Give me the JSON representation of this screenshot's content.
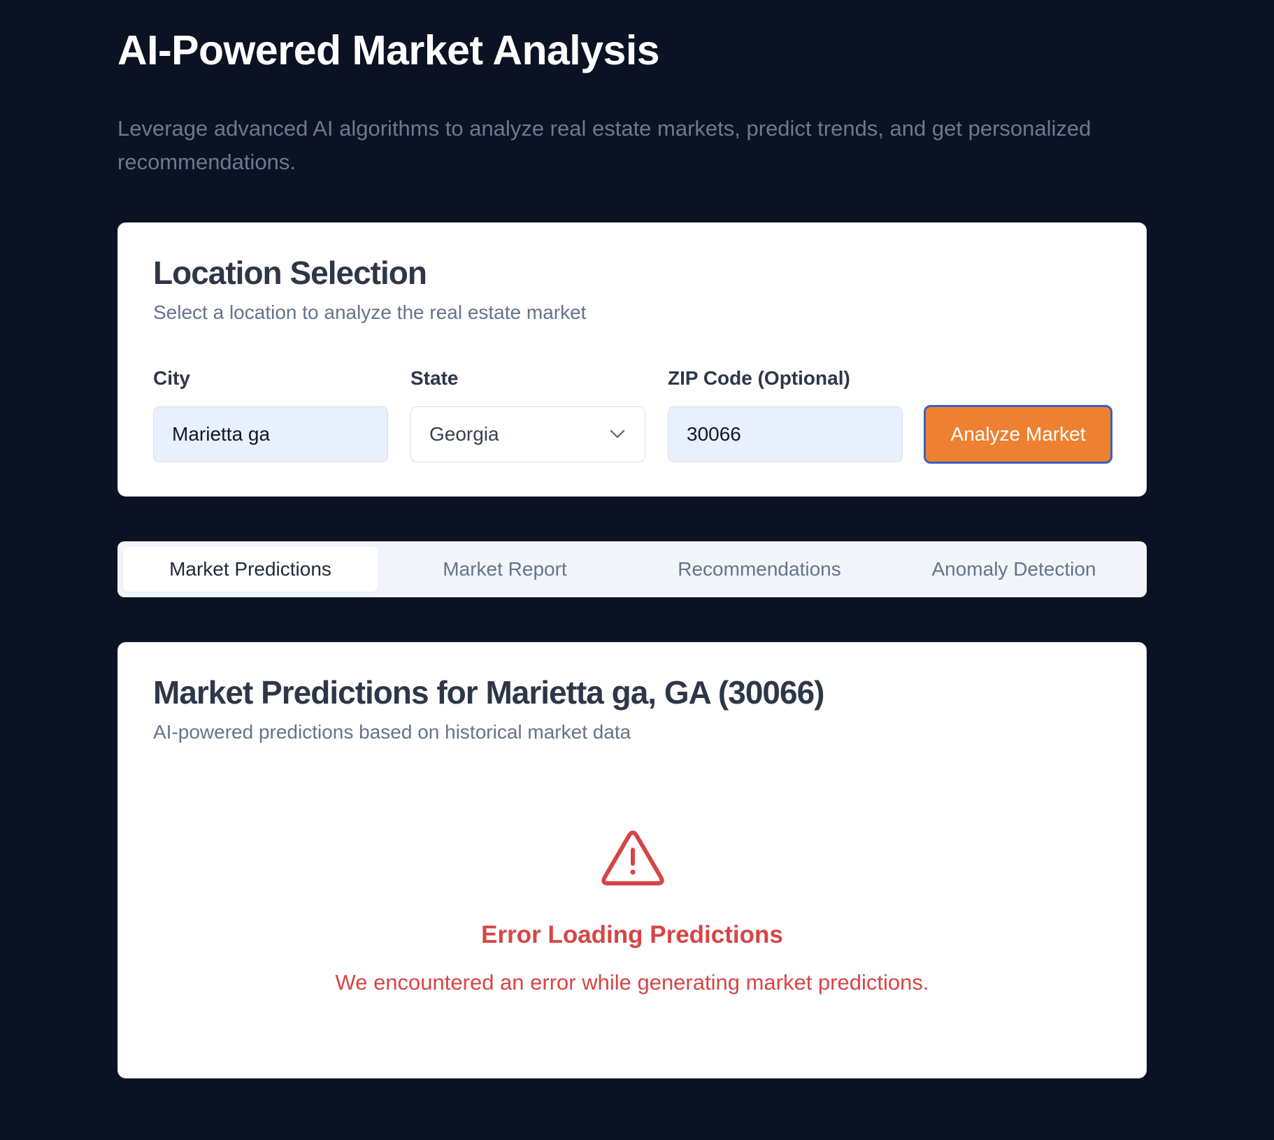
{
  "header": {
    "title": "AI-Powered Market Analysis",
    "subtitle": "Leverage advanced AI algorithms to analyze real estate markets, predict trends, and get personalized recommendations."
  },
  "location": {
    "title": "Location Selection",
    "description": "Select a location to analyze the real estate market",
    "city": {
      "label": "City",
      "value": "Marietta ga"
    },
    "state": {
      "label": "State",
      "value": "Georgia"
    },
    "zip": {
      "label": "ZIP Code (Optional)",
      "value": "30066"
    },
    "analyze_label": "Analyze Market"
  },
  "tabs": [
    {
      "label": "Market Predictions",
      "active": true
    },
    {
      "label": "Market Report",
      "active": false
    },
    {
      "label": "Recommendations",
      "active": false
    },
    {
      "label": "Anomaly Detection",
      "active": false
    }
  ],
  "predictions": {
    "title": "Market Predictions for Marietta ga, GA (30066)",
    "description": "AI-powered predictions based on historical market data",
    "error_icon": "warning-triangle-icon",
    "error_title": "Error Loading Predictions",
    "error_message": "We encountered an error while generating market predictions."
  },
  "colors": {
    "background": "#0a1223",
    "accent": "#ed8131",
    "focus_ring": "#3b5fc0",
    "error": "#d64545"
  }
}
